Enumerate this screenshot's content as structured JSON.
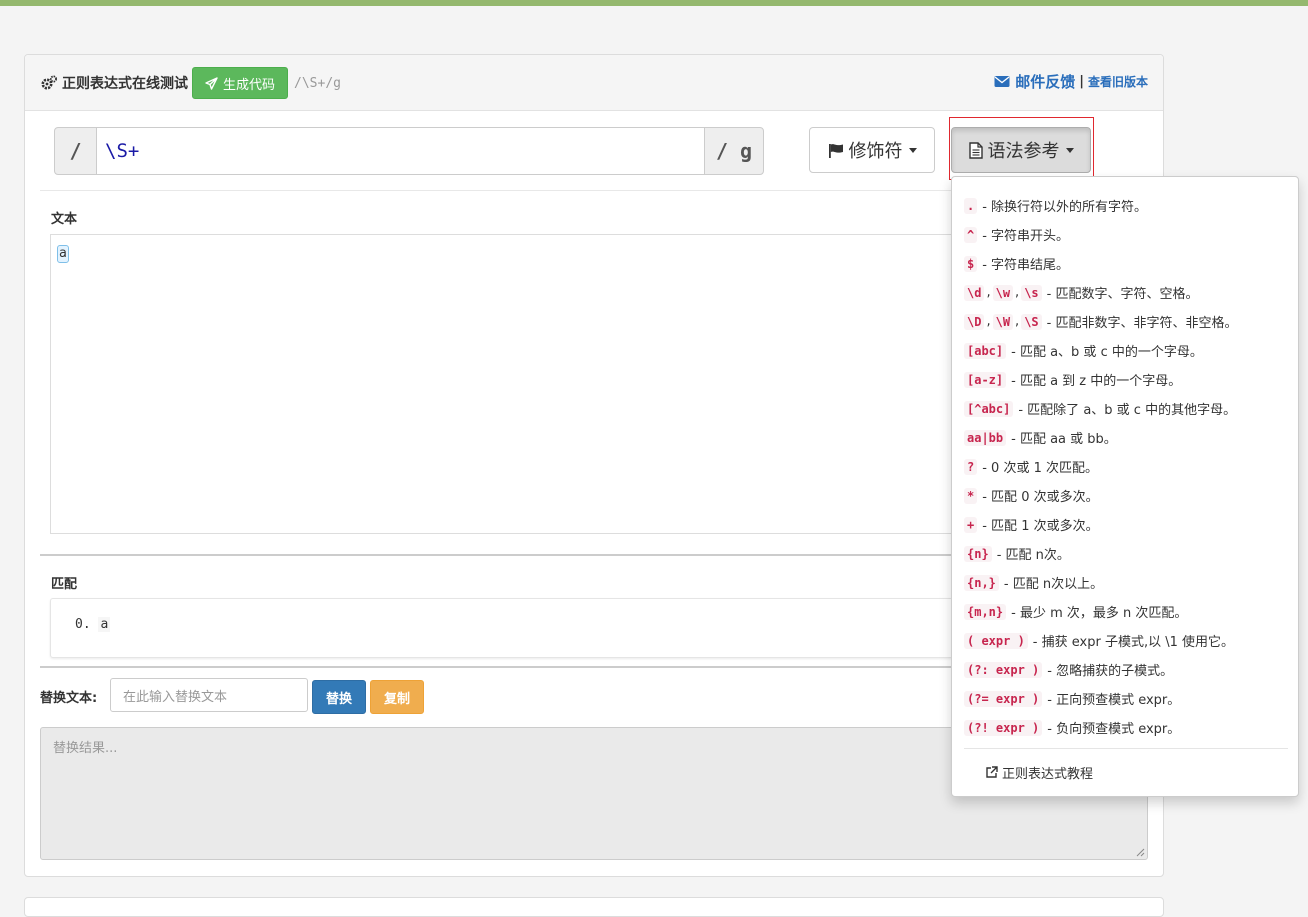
{
  "header": {
    "title": "正则表达式在线测试",
    "generate_code_label": "生成代码",
    "regex_display": "/\\S+/g",
    "feedback_label": "邮件反馈",
    "separator": "|",
    "old_version_label": "查看旧版本"
  },
  "regex": {
    "left_delim": "/",
    "pattern": "\\S+",
    "right_flags": "/ g"
  },
  "buttons": {
    "modifiers_label": "修饰符",
    "syntax_label": "语法参考"
  },
  "text_section": {
    "label": "文本",
    "content": "a"
  },
  "match_section": {
    "label": "匹配",
    "items": [
      {
        "index": "0.",
        "value": "a"
      }
    ]
  },
  "replace_section": {
    "label": "替换文本:",
    "input_placeholder": "在此输入替换文本",
    "replace_button": "替换",
    "copy_button": "复制",
    "result_placeholder": "替换结果..."
  },
  "syntax_dropdown": {
    "items": [
      {
        "codes": [
          "."
        ],
        "desc": "- 除换行符以外的所有字符。"
      },
      {
        "codes": [
          "^"
        ],
        "desc": "- 字符串开头。"
      },
      {
        "codes": [
          "$"
        ],
        "desc": "- 字符串结尾。"
      },
      {
        "codes": [
          "\\d",
          "\\w",
          "\\s"
        ],
        "desc": "- 匹配数字、字符、空格。"
      },
      {
        "codes": [
          "\\D",
          "\\W",
          "\\S"
        ],
        "desc": "- 匹配非数字、非字符、非空格。"
      },
      {
        "codes": [
          "[abc]"
        ],
        "desc": "- 匹配 a、b 或 c 中的一个字母。"
      },
      {
        "codes": [
          "[a-z]"
        ],
        "desc": "- 匹配 a 到 z 中的一个字母。"
      },
      {
        "codes": [
          "[^abc]"
        ],
        "desc": "- 匹配除了 a、b 或 c 中的其他字母。"
      },
      {
        "codes": [
          "aa|bb"
        ],
        "desc": "- 匹配 aa 或 bb。"
      },
      {
        "codes": [
          "?"
        ],
        "desc": "- 0 次或 1 次匹配。"
      },
      {
        "codes": [
          "*"
        ],
        "desc": "- 匹配 0 次或多次。"
      },
      {
        "codes": [
          "+"
        ],
        "desc": "- 匹配 1 次或多次。"
      },
      {
        "codes": [
          "{n}"
        ],
        "desc": "- 匹配 n次。"
      },
      {
        "codes": [
          "{n,}"
        ],
        "desc": "- 匹配 n次以上。"
      },
      {
        "codes": [
          "{m,n}"
        ],
        "desc": "- 最少 m 次，最多 n 次匹配。"
      },
      {
        "codes": [
          "( expr )"
        ],
        "desc": "- 捕获 expr 子模式,以 \\1 使用它。"
      },
      {
        "codes": [
          "(?: expr )"
        ],
        "desc": "- 忽略捕获的子模式。"
      },
      {
        "codes": [
          "(?= expr )"
        ],
        "desc": "- 正向预查模式 expr。"
      },
      {
        "codes": [
          "(?! expr )"
        ],
        "desc": "- 负向预查模式 expr。"
      }
    ],
    "footer_link": "正则表达式教程"
  },
  "colors": {
    "top_bar": "#94b86e",
    "success": "#5cb85c",
    "primary": "#337ab7",
    "warning": "#f0ad4e",
    "link": "#2a6ebb",
    "highlight_outline": "#e0282f",
    "code_text": "#c7254e"
  },
  "icons": [
    "cogs-icon",
    "paper-plane-icon",
    "envelope-icon",
    "flag-icon",
    "file-text-icon",
    "external-link-icon"
  ]
}
